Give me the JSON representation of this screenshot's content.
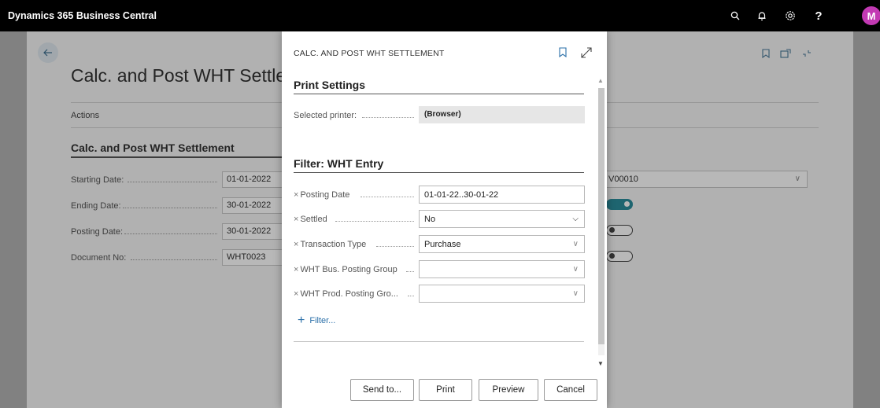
{
  "app": {
    "title": "Dynamics 365 Business Central",
    "avatar_initial": "M",
    "icons": [
      "search-icon",
      "bell-icon",
      "settings-icon",
      "help-icon"
    ],
    "help_glyph": "?"
  },
  "background_page": {
    "title": "Calc. and Post WHT Settlement",
    "actions_label": "Actions",
    "section_title": "Calc. and Post WHT Settlement",
    "fields": [
      {
        "label": "Starting Date:",
        "value": "01-01-2022"
      },
      {
        "label": "Ending Date:",
        "value": "30-01-2022"
      },
      {
        "label": "Posting Date:",
        "value": "30-01-2022"
      },
      {
        "label": "Document No:",
        "value": "WHT0023"
      }
    ],
    "right_field_value": "V00010",
    "toggles": [
      true,
      false,
      false
    ]
  },
  "dialog": {
    "caption": "CALC. AND POST WHT SETTLEMENT",
    "print_settings": {
      "title": "Print Settings",
      "printer_label": "Selected printer:",
      "printer_value": "(Browser)"
    },
    "filter": {
      "title": "Filter: WHT Entry",
      "clear_glyph": "×",
      "fields": [
        {
          "label": "Posting Date",
          "value": "01-01-22..30-01-22",
          "type": "text"
        },
        {
          "label": "Settled",
          "value": "No",
          "type": "select"
        },
        {
          "label": "Transaction Type",
          "value": "Purchase",
          "type": "select"
        },
        {
          "label": "WHT Bus. Posting Group",
          "value": "",
          "type": "select"
        },
        {
          "label": "WHT Prod. Posting Gro...",
          "value": "",
          "type": "select"
        }
      ],
      "add_filter_label": "Filter..."
    },
    "buttons": {
      "send_to": "Send to...",
      "print": "Print",
      "preview": "Preview",
      "cancel": "Cancel"
    }
  },
  "colors": {
    "accent": "#2a8c9c",
    "link": "#2a6fa8",
    "avatar": "#c239b3",
    "topbar": "#000000"
  }
}
